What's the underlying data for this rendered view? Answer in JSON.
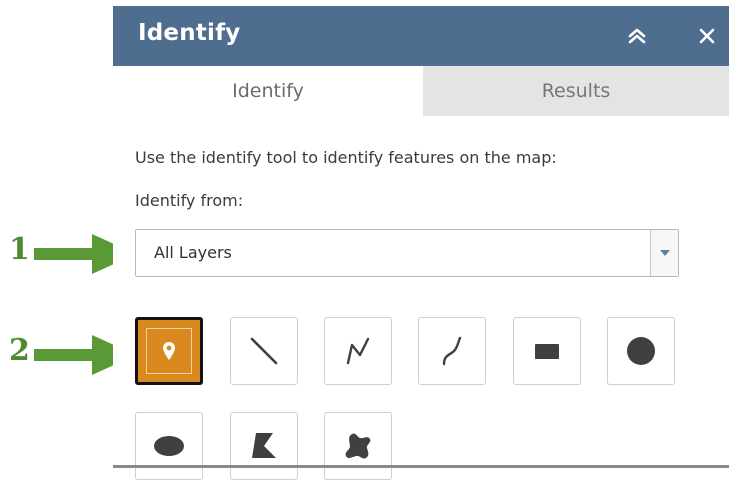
{
  "panel": {
    "title": "Identify",
    "collapse_icon": "double-chevron-up-icon",
    "close_icon": "close-icon"
  },
  "tabs": [
    {
      "label": "Identify",
      "active": true
    },
    {
      "label": "Results",
      "active": false
    }
  ],
  "identify": {
    "instructions": "Use the identify tool to identify features on the map:",
    "from_label": "Identify from:",
    "layer_select": {
      "selected": "All Layers"
    }
  },
  "tools": [
    {
      "name": "point-tool",
      "icon": "map-pin-icon",
      "selected": true
    },
    {
      "name": "line-tool",
      "icon": "line-icon",
      "selected": false
    },
    {
      "name": "polyline-tool",
      "icon": "polyline-icon",
      "selected": false
    },
    {
      "name": "freehand-line-tool",
      "icon": "freehand-line-icon",
      "selected": false
    },
    {
      "name": "extent-tool",
      "icon": "rectangle-icon",
      "selected": false
    },
    {
      "name": "circle-tool",
      "icon": "circle-icon",
      "selected": false
    },
    {
      "name": "ellipse-tool",
      "icon": "ellipse-icon",
      "selected": false
    },
    {
      "name": "polygon-tool",
      "icon": "polygon-icon",
      "selected": false
    },
    {
      "name": "freehand-polygon-tool",
      "icon": "freehand-polygon-icon",
      "selected": false
    }
  ],
  "callouts": [
    {
      "number": "1"
    },
    {
      "number": "2"
    }
  ],
  "colors": {
    "titlebar": "#4f6d8f",
    "selected_tool": "#d98a1e",
    "callout": "#4e8a2f"
  }
}
